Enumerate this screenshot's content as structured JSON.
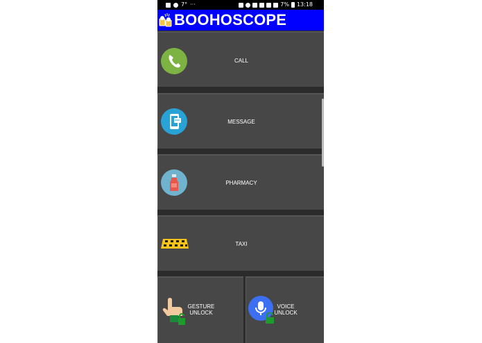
{
  "status_bar": {
    "notif": "7°",
    "more": "···",
    "battery": "7%",
    "time": "13:18"
  },
  "app": {
    "title": "BOOHOSCOPE"
  },
  "tiles": {
    "call": "CALL",
    "message": "MESSAGE",
    "pharmacy": "PHARMACY",
    "taxi": "TAXI",
    "gesture_unlock": [
      "GESTURE",
      "UNLOCK"
    ],
    "voice_unlock": [
      "VOICE",
      "UNLOCK"
    ]
  },
  "colors": {
    "appbar": "#0000ff",
    "tile": "#474747",
    "call_icon": "#7cb342",
    "message_icon": "#29a3d6",
    "pharmacy_icon": "#6fb3cf",
    "voice_icon": "#3d6ff2",
    "lock_green": "#1f9a2d"
  }
}
